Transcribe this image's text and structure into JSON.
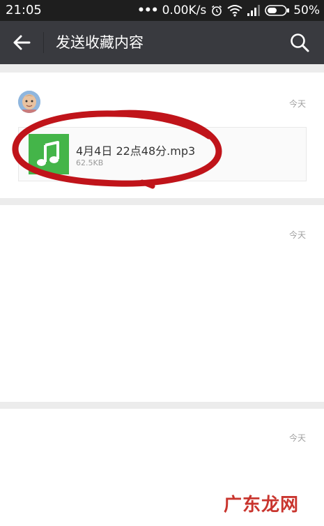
{
  "status_bar": {
    "time": "21:05",
    "network_speed": "0.00K/s",
    "battery_percent": "50%",
    "icons": [
      "more-dots-icon",
      "alarm-icon",
      "wifi-icon",
      "signal-icon",
      "battery-icon"
    ]
  },
  "app_bar": {
    "title": "发送收藏内容",
    "icons": [
      "back-arrow-icon",
      "search-icon"
    ],
    "background": "#393a3f"
  },
  "favorites": [
    {
      "date": "今天",
      "file": {
        "name": "4月4日 22点48分.mp3",
        "size": "62.5KB",
        "icon": "music-note-icon",
        "icon_color": "#44b549"
      },
      "highlighted": true
    },
    {
      "date": "今天"
    },
    {
      "date": "今天"
    }
  ],
  "highlight_color": "#c0141a",
  "watermark": "广东龙网"
}
